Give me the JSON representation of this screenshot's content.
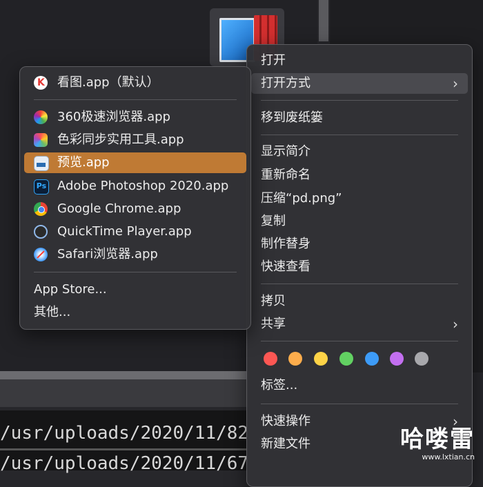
{
  "background": {
    "terminal_lines": [
      "/usr/uploads/2020/11/82",
      "/usr/uploads/2020/11/67"
    ]
  },
  "context_menu": {
    "items": [
      {
        "label": "打开"
      },
      {
        "label": "打开方式",
        "submenu": true
      },
      {
        "label": "移到废纸篓"
      },
      {
        "label": "显示简介"
      },
      {
        "label": "重新命名"
      },
      {
        "label": "压缩“pd.png”"
      },
      {
        "label": "复制"
      },
      {
        "label": "制作替身"
      },
      {
        "label": "快速查看"
      },
      {
        "label": "拷贝"
      },
      {
        "label": "共享",
        "submenu": true
      },
      {
        "label": "标签..."
      },
      {
        "label": "快速操作",
        "submenu": true
      },
      {
        "label": "新建文件"
      }
    ],
    "tag_colors": [
      "#fc5753",
      "#fdad4c",
      "#fed347",
      "#62d162",
      "#3d9bf7",
      "#c36ff0",
      "#a8a8ac"
    ],
    "submenu_arrow": "›"
  },
  "open_with_submenu": {
    "default_app": {
      "label": "看图.app（默认）",
      "icon": "kantu-icon"
    },
    "apps": [
      {
        "label": "360极速浏览器.app",
        "icon": "browser-360-icon"
      },
      {
        "label": "色彩同步实用工具.app",
        "icon": "colorsync-icon"
      },
      {
        "label": "预览.app",
        "icon": "preview-icon",
        "highlighted": true
      },
      {
        "label": "Adobe Photoshop 2020.app",
        "icon": "photoshop-icon"
      },
      {
        "label": "Google Chrome.app",
        "icon": "chrome-icon"
      },
      {
        "label": "QuickTime Player.app",
        "icon": "quicktime-icon"
      },
      {
        "label": "Safari浏览器.app",
        "icon": "safari-icon"
      }
    ],
    "extras": [
      {
        "label": "App Store..."
      },
      {
        "label": "其他..."
      }
    ],
    "highlight_color": "#bf7a34"
  },
  "watermark": {
    "title": "哈喽雷",
    "url": "www.lxtian.cn"
  }
}
